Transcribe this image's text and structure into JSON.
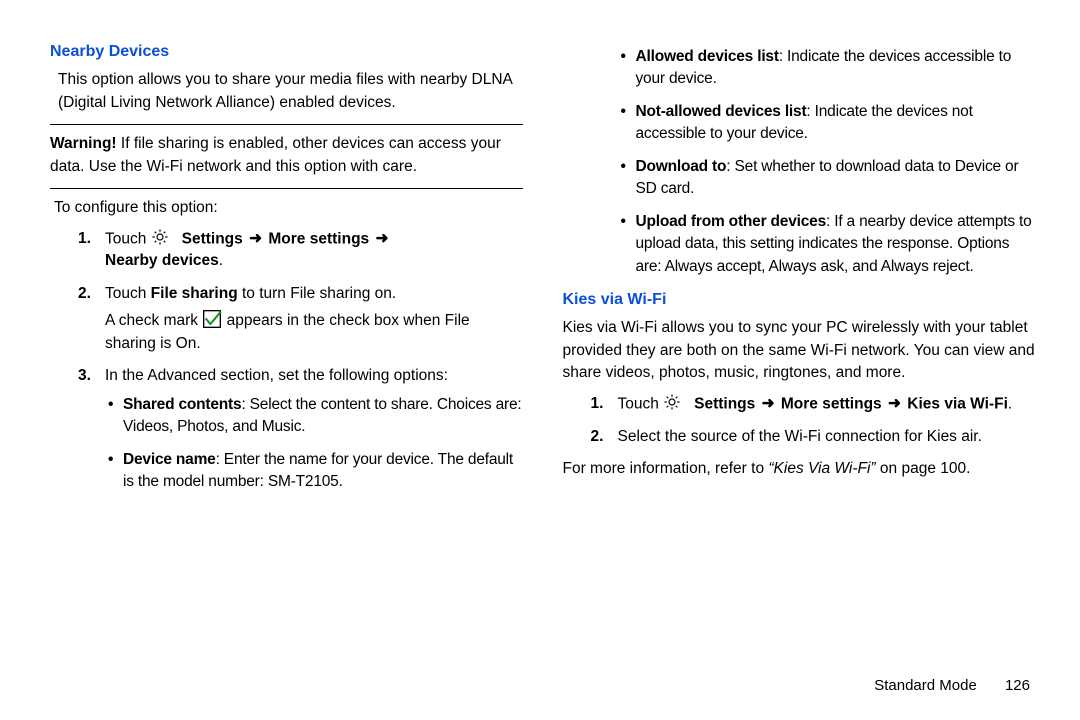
{
  "left": {
    "heading": "Nearby Devices",
    "intro": "This option allows you to share your media files with nearby DLNA (Digital Living Network Alliance) enabled devices.",
    "warning_label": "Warning!",
    "warning_text": "If file sharing is enabled, other devices can access your data. Use the Wi-Fi network and this option with care.",
    "configure_line": "To configure this option:",
    "step1_touch": "Touch ",
    "step1_path_a": "Settings",
    "step1_path_b": "More settings",
    "step1_path_c": "Nearby devices",
    "step2_a": "Touch ",
    "step2_b": "File sharing",
    "step2_c": " to turn File sharing on.",
    "step2_line2_a": "A check mark ",
    "step2_line2_b": " appears in the check box when File sharing is On.",
    "step3": "In the Advanced section, set the following options:",
    "adv1_b": "Shared contents",
    "adv1_t": ": Select the content to share. Choices are: Videos, Photos, and Music.",
    "adv2_b": "Device name",
    "adv2_t": ": Enter the name for your device. The default is the model number: SM-T2105."
  },
  "right": {
    "b1_b": "Allowed devices list",
    "b1_t": ": Indicate the devices accessible to your device.",
    "b2_b": "Not-allowed devices list",
    "b2_t": ": Indicate the devices not accessible to your device.",
    "b3_b": "Download to",
    "b3_t": ": Set whether to download data to Device or SD card.",
    "b4_b": "Upload from other devices",
    "b4_t": ": If a nearby device attempts to upload data, this setting indicates the response. Options are: Always accept, Always ask, and Always reject.",
    "heading": "Kies via Wi-Fi",
    "intro": "Kies via Wi-Fi allows you to sync your PC wirelessly with your tablet provided they are both on the same Wi-Fi network. You can view and share videos, photos, music, ringtones, and more.",
    "step1_touch": "Touch ",
    "step1_a": "Settings",
    "step1_b": "More settings",
    "step1_c": "Kies via Wi-Fi",
    "step2": "Select the source of the Wi-Fi connection for Kies air.",
    "moreinfo_a": "For more information, refer to ",
    "moreinfo_ref": "“Kies Via Wi-Fi”",
    "moreinfo_b": " on page 100."
  },
  "footer": {
    "mode": "Standard Mode",
    "page": "126"
  },
  "glyph": {
    "arrow": "➜"
  }
}
